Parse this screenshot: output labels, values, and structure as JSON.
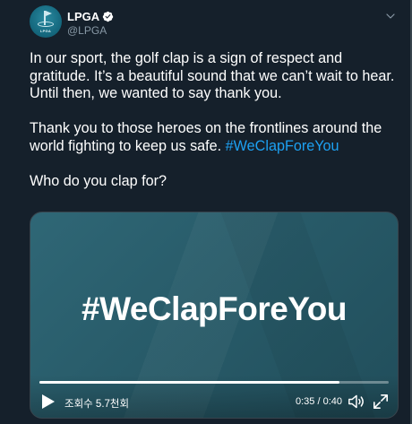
{
  "tweet": {
    "author": {
      "name": "LPGA",
      "handle": "@LPGA",
      "avatar_text": "LPGA"
    },
    "paragraphs": [
      "In our sport, the golf clap is a sign of respect and gratitude. It’s a beautiful sound that we can’t wait to hear. Until then, we wanted to say thank you.",
      "Thank you to those heroes on the frontlines around the world fighting to keep us safe.",
      "Who do you clap for?"
    ],
    "hashtag": "#WeClapForeYou"
  },
  "video": {
    "overlay_title": "#WeClapForeYou",
    "views": "조회수 5.7천회",
    "time": "0:35 / 0:40",
    "progress": 0.86
  },
  "icons": {
    "verified": "verified-badge-icon",
    "menu": "chevron-down-icon",
    "play": "play-icon",
    "volume": "volume-icon",
    "fullscreen": "fullscreen-icon"
  },
  "colors": {
    "background": "#15202b",
    "link": "#1da1f2",
    "secondary_text": "#8899a6"
  }
}
